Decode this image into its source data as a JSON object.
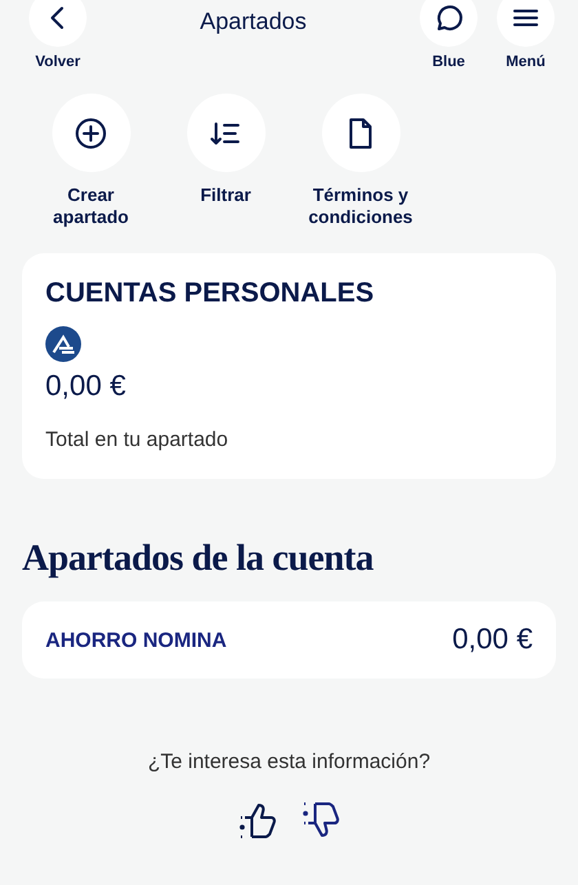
{
  "header": {
    "title": "Apartados",
    "back": {
      "label": "Volver"
    },
    "actions": [
      {
        "kind": "chat",
        "label": "Blue"
      },
      {
        "kind": "menu",
        "label": "Menú"
      }
    ]
  },
  "quick_actions": [
    {
      "kind": "add",
      "label": "Crear apartado"
    },
    {
      "kind": "sort",
      "label": "Filtrar"
    },
    {
      "kind": "document",
      "label": "Términos y condiciones"
    }
  ],
  "account_card": {
    "title": "CUENTAS PERSONALES",
    "amount": "0,00 €",
    "caption": "Total en tu apartado"
  },
  "section_title": "Apartados de la cuenta",
  "savings": [
    {
      "name": "AHORRO NOMINA",
      "amount": "0,00 €"
    }
  ],
  "feedback": {
    "question": "¿Te interesa esta información?"
  }
}
